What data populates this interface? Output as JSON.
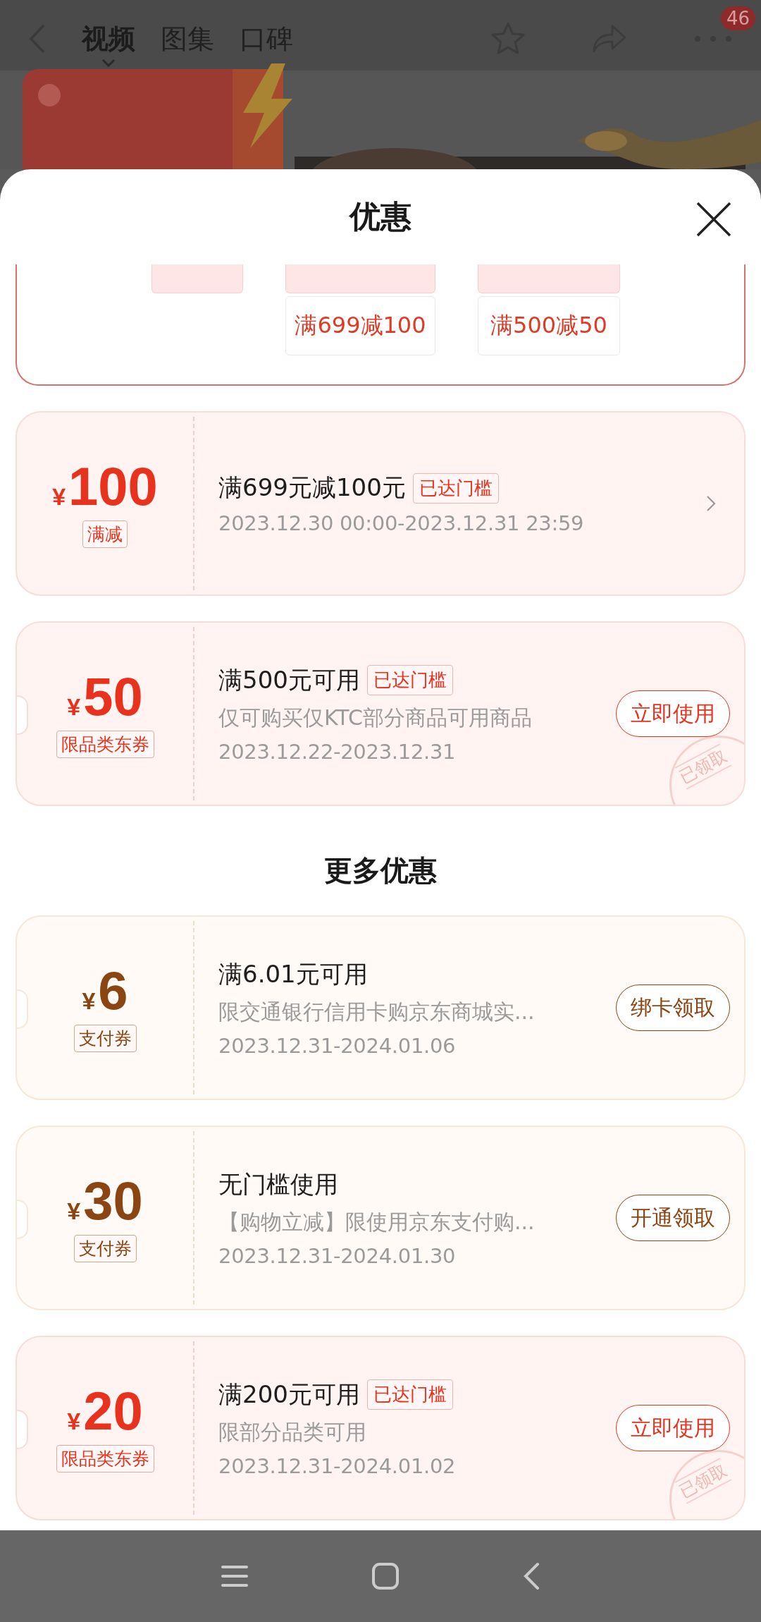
{
  "top_bar": {
    "tabs": [
      {
        "label": "视频",
        "selected": true
      },
      {
        "label": "图集",
        "selected": false
      },
      {
        "label": "口碑",
        "selected": false
      }
    ],
    "badge": "46"
  },
  "banner": {
    "kind": "picture"
  },
  "sheet": {
    "title": "优惠"
  },
  "promo_values": [
    "满699减100",
    "满500减50"
  ],
  "coupons": [
    {
      "kind": "store",
      "symbol": "¥",
      "amount": "100",
      "type_tag": "满减",
      "title": "满699元减100元",
      "threshold_tag": "已达门槛",
      "dates": "2023.12.30 00:00-2023.12.31 23:59",
      "action": {
        "kind": "chevron"
      },
      "claimed": false
    },
    {
      "kind": "store",
      "symbol": "¥",
      "amount": "50",
      "type_tag": "限品类东券",
      "title": "满500元可用",
      "threshold_tag": "已达门槛",
      "description": "仅可购买仅KTC部分商品可用商品",
      "dates": "2023.12.22-2023.12.31",
      "action": {
        "kind": "button",
        "label": "立即使用"
      },
      "claimed": true,
      "stamp": "已领取"
    }
  ],
  "more_title": "更多优惠",
  "more_coupons": [
    {
      "kind": "payment",
      "symbol": "¥",
      "amount": "6",
      "type_tag": "支付券",
      "title": "满6.01元可用",
      "description": "限交通银行信用卡购京东商城实...",
      "dates": "2023.12.31-2024.01.06",
      "action": {
        "kind": "button",
        "label": "绑卡领取"
      },
      "claimed": false
    },
    {
      "kind": "payment",
      "symbol": "¥",
      "amount": "30",
      "type_tag": "支付券",
      "title": "无门槛使用",
      "description": "【购物立减】限使用京东支付购...",
      "dates": "2023.12.31-2024.01.30",
      "action": {
        "kind": "button",
        "label": "开通领取"
      },
      "claimed": false
    },
    {
      "kind": "store",
      "symbol": "¥",
      "amount": "20",
      "type_tag": "限品类东券",
      "title": "满200元可用",
      "threshold_tag": "已达门槛",
      "description": "限部分品类可用",
      "dates": "2023.12.31-2024.01.02",
      "action": {
        "kind": "button",
        "label": "立即使用"
      },
      "claimed": true,
      "stamp": "已领取"
    }
  ]
}
